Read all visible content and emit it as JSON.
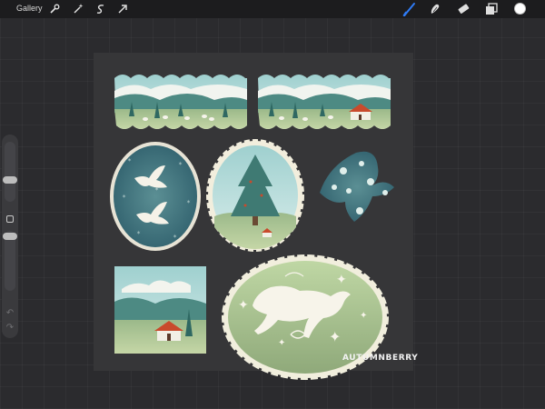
{
  "topbar": {
    "gallery_label": "Gallery",
    "left_tools": [
      "wrench-icon",
      "magic-wand-icon",
      "selection-icon",
      "transform-arrow-icon"
    ],
    "right_tools": [
      "brush-icon",
      "smudge-icon",
      "eraser-icon",
      "layers-icon",
      "color-picker-icon"
    ],
    "active_tool": "brush",
    "active_color": "#ffffff",
    "accent_color": "#2f7bf5"
  },
  "sidebar": {
    "brush_size_slider": "size-slider",
    "opacity_slider": "opacity-slider",
    "modify_button": "square-icon",
    "undo_icon": "undo-icon",
    "redo_icon": "redo-icon"
  },
  "canvas": {
    "signature": "AUTUMNBERRY",
    "stickers": [
      "winter-landscape-banner-sheep",
      "winter-landscape-banner-house",
      "oval-doves-badge",
      "scalloped-christmas-tree-badge",
      "bird-silhouette-floral",
      "square-house-landscape",
      "scalloped-oval-horse-stars"
    ]
  }
}
